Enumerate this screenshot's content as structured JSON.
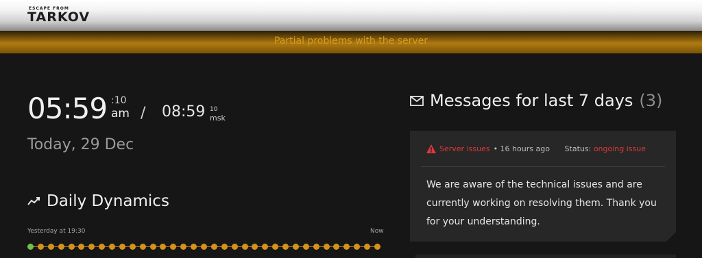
{
  "header": {
    "logo_small": "ESCAPE FROM",
    "logo_big": "TARKOV"
  },
  "banner": {
    "text": "Partial problems with the server",
    "color": "#d89a1e"
  },
  "clock": {
    "time": "05:59",
    "seconds": ":10",
    "ampm": "am",
    "separator": "/",
    "msk_time": "08:59",
    "msk_seconds": "10",
    "msk_label": "msk"
  },
  "date": "Today, 29 Dec",
  "daily_dynamics": {
    "title": "Daily Dynamics",
    "from_label": "Yesterday at 19:30",
    "to_label": "Now",
    "status_points": [
      "ok",
      "issue",
      "issue",
      "issue",
      "issue",
      "issue",
      "issue",
      "issue",
      "issue",
      "issue",
      "issue",
      "issue",
      "issue",
      "issue",
      "issue",
      "issue",
      "issue",
      "issue",
      "issue",
      "issue",
      "issue",
      "issue",
      "issue",
      "issue",
      "issue",
      "issue",
      "issue",
      "issue",
      "issue",
      "issue",
      "issue",
      "issue",
      "issue",
      "issue",
      "issue"
    ],
    "colors": {
      "ok": "#6cc24a",
      "issue": "#d4921c"
    }
  },
  "messages": {
    "title": "Messages for last 7 days",
    "count": "(3)",
    "items": [
      {
        "kind": "Server issues",
        "time": " • 16 hours ago",
        "status_label": "Status: ",
        "status": "ongoing issue",
        "body": "We are aware of the technical issues and are currently working on resolving them. Thank you for your understanding."
      }
    ]
  }
}
